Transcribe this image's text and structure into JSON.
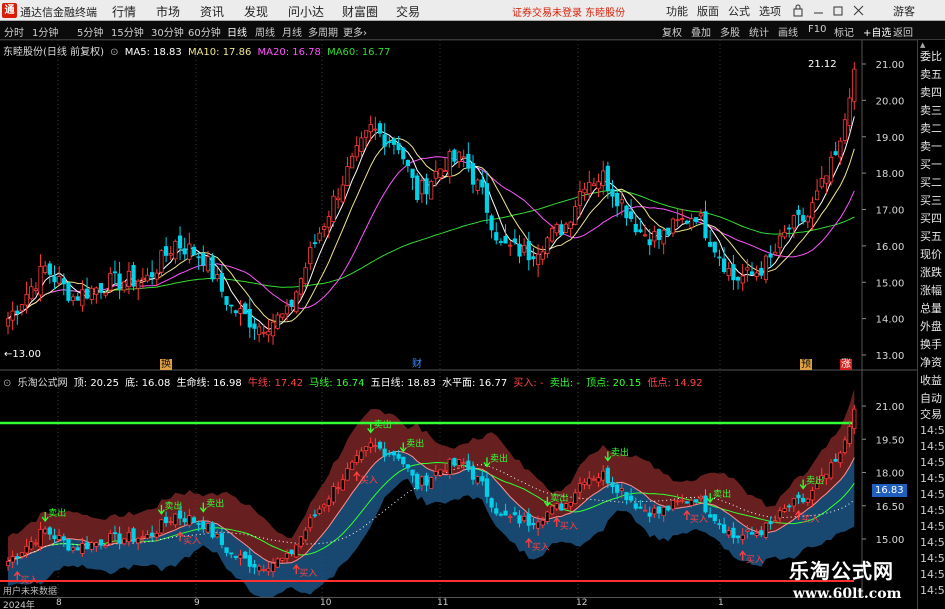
{
  "app": {
    "logo_glyph": "通",
    "name": "通达信金融终端",
    "menus": [
      "行情",
      "市场",
      "资讯",
      "发现",
      "问小达",
      "财富圈",
      "交易"
    ],
    "notice": "证券交易未登录  东睦股份",
    "tools": [
      "功能",
      "版面",
      "公式",
      "选项"
    ],
    "guest": "游客",
    "colors": {
      "menubar_bg": "#ececec",
      "chart_bg": "#000000",
      "up": "#ff3b3b",
      "down": "#00d0e8",
      "highlight": "#33ff33"
    }
  },
  "toolbar": {
    "periods": [
      "分时",
      "1分钟",
      "5分钟",
      "15分钟",
      "30分钟",
      "60分钟",
      "日线",
      "周线",
      "月线",
      "多周期",
      "更多›"
    ],
    "active_period": "日线",
    "right_buttons": [
      "复权",
      "叠加",
      "多股",
      "统计",
      "画线",
      "F10",
      "标记",
      "+自选",
      "返回"
    ]
  },
  "main_chart": {
    "title": "东睦股份(日线 前复权)",
    "ma_legend": [
      {
        "label": "MA5: 18.83",
        "color": "#ffffff"
      },
      {
        "label": "MA10: 17.86",
        "color": "#f0e68c"
      },
      {
        "label": "MA20: 16.78",
        "color": "#ff55ff"
      },
      {
        "label": "MA60: 16.77",
        "color": "#33dd33"
      }
    ],
    "y_ticks": [
      "21.00",
      "20.00",
      "19.00",
      "18.00",
      "17.00",
      "16.00",
      "15.00",
      "14.00",
      "13.00"
    ],
    "low_mark": "←13.00",
    "high_mark": "21.12",
    "event_markers": [
      "换",
      "财",
      "预",
      "涨"
    ]
  },
  "indicator": {
    "name": "乐淘公式网",
    "values": [
      {
        "label": "顶: 20.25",
        "color": "#ffffff"
      },
      {
        "label": "底: 16.08",
        "color": "#ffffff"
      },
      {
        "label": "生命线: 16.98",
        "color": "#ffffff"
      },
      {
        "label": "牛线: 17.42",
        "color": "#ff4444"
      },
      {
        "label": "马线: 16.74",
        "color": "#33ff33"
      },
      {
        "label": "五日线: 18.83",
        "color": "#ffffff"
      },
      {
        "label": "水平面: 16.77",
        "color": "#ffffff"
      },
      {
        "label": "买入: -",
        "color": "#ff4444"
      },
      {
        "label": "卖出: -",
        "color": "#33ff33"
      },
      {
        "label": "顶点: 20.15",
        "color": "#33ff33"
      },
      {
        "label": "低点: 14.92",
        "color": "#ff4444"
      }
    ],
    "y_ticks": [
      "21.00",
      "19.50",
      "18.00",
      "16.50",
      "15.00"
    ],
    "current_value": "16.83",
    "buy_label": "买入",
    "sell_label": "卖出",
    "status_text": "用户未来数据"
  },
  "quote_panel": {
    "rows": [
      "委比",
      "卖五",
      "卖四",
      "卖三",
      "卖二",
      "卖一",
      "买一",
      "买二",
      "买三",
      "买四",
      "买五",
      "现价",
      "涨跌",
      "涨幅",
      "总量",
      "外盘",
      "换手",
      "净资",
      "收益",
      "自动",
      "交易"
    ],
    "time_rows": [
      "14:50",
      "14:50",
      "14:50",
      "14:50",
      "14:50",
      "14:50",
      "14:50",
      "14:50",
      "14:50",
      "14:50",
      "14:50"
    ]
  },
  "x_axis": {
    "labels": [
      "2024年",
      "8",
      "9",
      "10",
      "11",
      "12",
      "1"
    ]
  },
  "watermark": {
    "title": "乐淘公式网",
    "url": "www.60lt.com"
  }
}
